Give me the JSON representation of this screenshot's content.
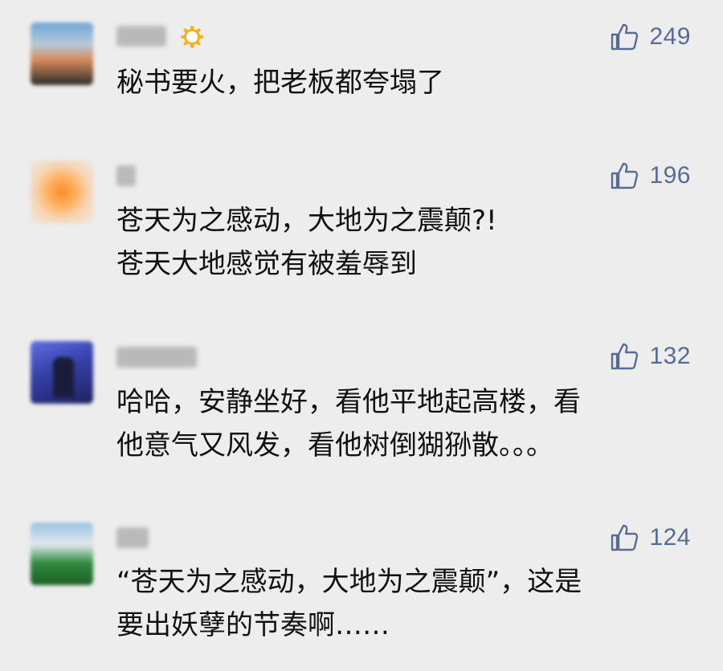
{
  "comments": [
    {
      "avatar_icon": "avatar-icon",
      "name": "",
      "name_icon": "sun-icon",
      "likes": "249",
      "lines": [
        "秘书要火，把老板都夸塌了"
      ]
    },
    {
      "avatar_icon": "avatar-icon",
      "name": "",
      "likes": "196",
      "lines": [
        "苍天为之感动，大地为之震颠?!",
        "苍天大地感觉有被羞辱到"
      ]
    },
    {
      "avatar_icon": "avatar-icon",
      "name": "",
      "likes": "132",
      "lines": [
        "哈哈，安静坐好，看他平地起高楼，看",
        "他意气又风发，看他树倒猢狲散。。。"
      ]
    },
    {
      "avatar_icon": "avatar-icon",
      "name": "",
      "likes": "124",
      "lines": [
        "“苍天为之感动，大地为之震颠”，这是",
        "要出妖孽的节奏啊……"
      ]
    }
  ],
  "icons": {
    "like": "thumbs-up-icon"
  },
  "colors": {
    "background": "#ededed",
    "like_count": "#576b95",
    "text": "#111111"
  }
}
